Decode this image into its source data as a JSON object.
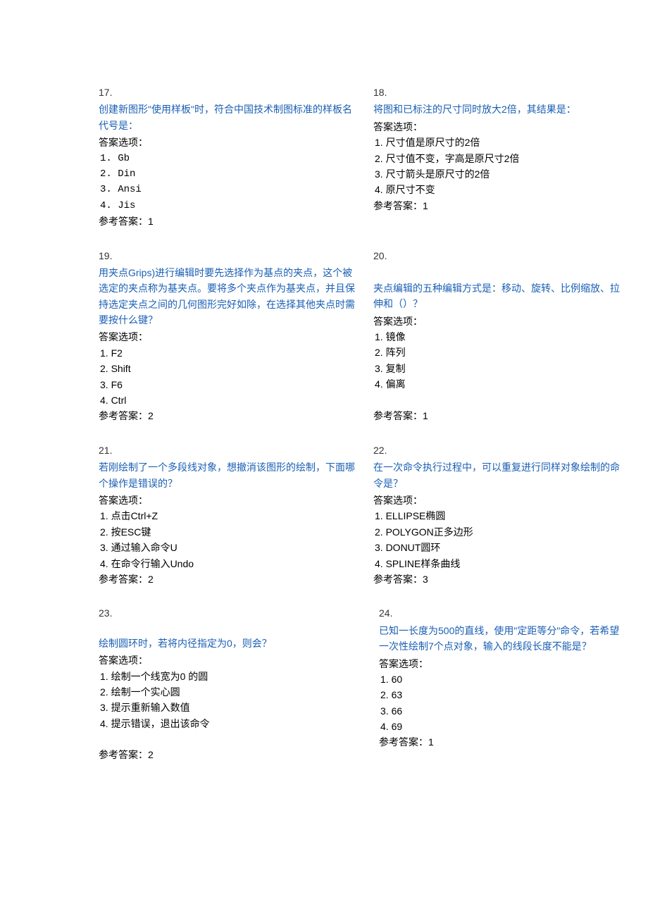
{
  "labels": {
    "options_label": "答案选项：",
    "answer_label_prefix": "参考答案："
  },
  "q17": {
    "num": "17.",
    "text": "创建新图形\"使用样板\"时，符合中国技术制图标准的样板名代号是：",
    "opts": [
      "1. Gb",
      "2. Din",
      "3. Ansi",
      "4. Jis"
    ],
    "answer": "参考答案：1"
  },
  "q18": {
    "num": "18.",
    "text": "将图和已标注的尺寸同时放大2倍，其结果是：",
    "opts": [
      "1.  尺寸值是原尺寸的2倍",
      "2.  尺寸值不变，字高是原尺寸2倍",
      "3.  尺寸箭头是原尺寸的2倍",
      "4.  原尺寸不变"
    ],
    "answer": "参考答案：1"
  },
  "q19": {
    "num": "19.",
    "text": "用夹点Grips)进行编辑时要先选择作为基点的夹点，这个被选定的夹点称为基夹点。要将多个夹点作为基夹点，并且保持选定夹点之间的几何图形完好如除，在选择其他夹点时需要按什么键？",
    "opts": [
      "1.   F2",
      "2.   Shift",
      "3.   F6",
      "4.  Ctrl"
    ],
    "answer": "参考答案：2"
  },
  "q20": {
    "num": "20.",
    "text": "夹点编辑的五种编辑方式是：移动、旋转、比例缩放、拉伸和（）？",
    "opts": [
      "1.  镜像",
      "2.  阵列",
      "3.  复制",
      "4.  偏离"
    ],
    "answer": "参考答案：1"
  },
  "q21": {
    "num": "21.",
    "text": "若刚绘制了一个多段线对象，想撤消该图形的绘制，下面哪个操作是错误的？",
    "opts": [
      "1.  点击Ctrl+Z",
      "2.  按ESC键",
      "3.  通过输入命令U",
      "4.  在命令行输入Undo"
    ],
    "answer": "参考答案：2"
  },
  "q22": {
    "num": "22.",
    "text": "在一次命令执行过程中，可以重复进行同样对象绘制的命令是？",
    "opts": [
      "1. ELLIPSE椭圆",
      "2. POLYGON正多边形",
      "3. DONUT圆环",
      "4. SPLINE样条曲线"
    ],
    "answer": "参考答案：3"
  },
  "q23": {
    "num": "23.",
    "text": "绘制圆环时，若将内径指定为0，则会？",
    "opts": [
      "1.  绘制一个线宽为0 的圆",
      "2.  绘制一个实心圆",
      "3.  提示重新输入数值",
      "4.  提示错误，退出该命令"
    ],
    "answer": "参考答案：2"
  },
  "q24": {
    "num": "24.",
    "text": "已知一长度为500的直线，使用\"定距等分\"命令，若希望一次性绘制7个点对象，输入的线段长度不能是？",
    "opts": [
      "1.  60",
      "2.  63",
      "3.  66",
      "4.  69"
    ],
    "answer": "参考答案：1"
  }
}
